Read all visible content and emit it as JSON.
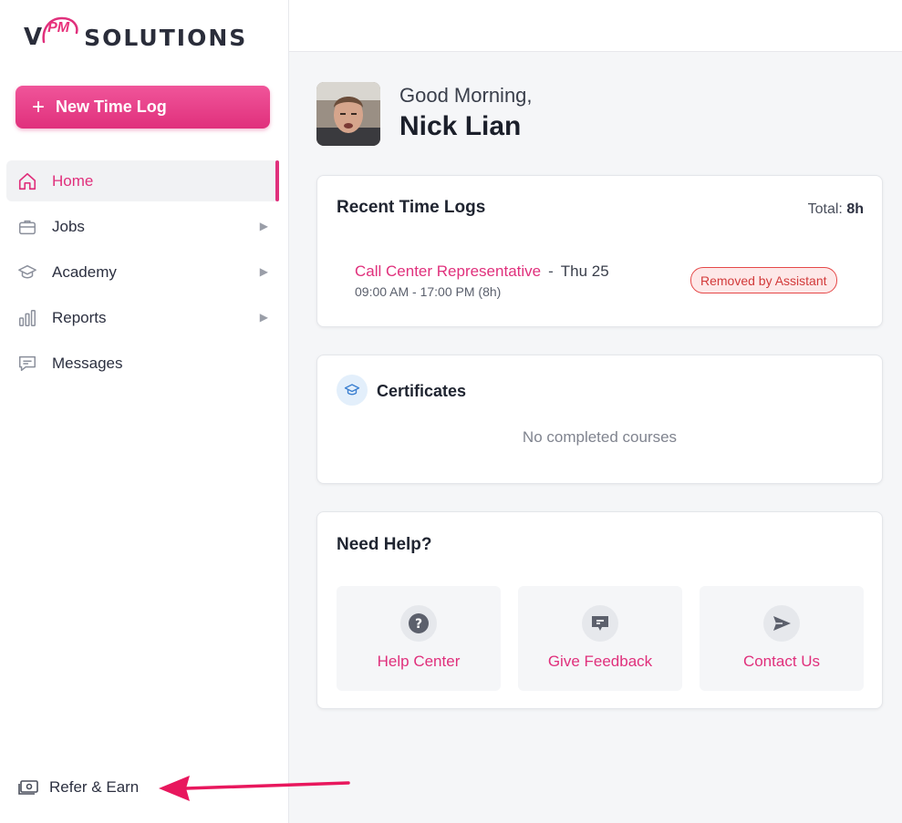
{
  "brand": {
    "prefix": "V",
    "mark": "PM",
    "name": "SOLUTIONS",
    "accent": "#e0307c"
  },
  "sidebar": {
    "new_button": {
      "label": "New Time Log",
      "icon": "plus-icon"
    },
    "items": [
      {
        "label": "Home",
        "icon": "home-icon",
        "active": true
      },
      {
        "label": "Jobs",
        "icon": "briefcase-icon",
        "expandable": true
      },
      {
        "label": "Academy",
        "icon": "graduation-cap-icon",
        "expandable": true
      },
      {
        "label": "Reports",
        "icon": "bar-chart-icon",
        "expandable": true
      },
      {
        "label": "Messages",
        "icon": "message-icon"
      }
    ],
    "footer": {
      "label": "Refer & Earn",
      "icon": "money-icon"
    }
  },
  "greeting": {
    "line": "Good Morning,",
    "name": "Nick Lian"
  },
  "recent_logs": {
    "title": "Recent Time Logs",
    "total_label": "Total:",
    "total_value": "8h",
    "entries": [
      {
        "job": "Call Center Representative",
        "separator": "-",
        "day": "Thu 25",
        "time": "09:00 AM - 17:00 PM (8h)",
        "status": "Removed by Assistant"
      }
    ]
  },
  "certificates": {
    "title": "Certificates",
    "empty_text": "No completed courses",
    "icon": "graduation-cap-icon"
  },
  "help": {
    "title": "Need Help?",
    "tiles": [
      {
        "label": "Help Center",
        "icon": "question-icon"
      },
      {
        "label": "Give Feedback",
        "icon": "feedback-icon"
      },
      {
        "label": "Contact Us",
        "icon": "send-icon"
      }
    ]
  }
}
